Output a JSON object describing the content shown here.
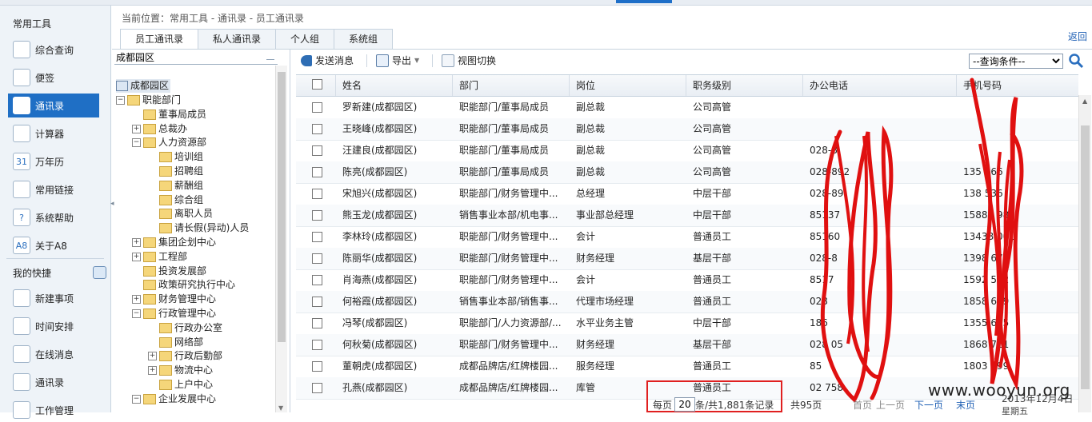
{
  "breadcrumb": "当前位置：常用工具 - 通讯录 - 员工通讯录",
  "back_link": "返回",
  "tabs": [
    "员工通讯录",
    "私人通讯录",
    "个人组",
    "系统组"
  ],
  "sidebar": {
    "section1": "常用工具",
    "items1": [
      {
        "label": "综合查询",
        "icon": "search-doc-icon"
      },
      {
        "label": "便签",
        "icon": "note-icon"
      },
      {
        "label": "通讯录",
        "icon": "contacts-icon",
        "active": true
      },
      {
        "label": "计算器",
        "icon": "calculator-icon"
      },
      {
        "label": "万年历",
        "icon": "calendar-icon",
        "glyph": "31"
      },
      {
        "label": "常用链接",
        "icon": "link-icon"
      },
      {
        "label": "系统帮助",
        "icon": "help-icon",
        "glyph": "?"
      },
      {
        "label": "关于A8",
        "icon": "a8-icon",
        "glyph": "A8"
      }
    ],
    "section2": "我的快捷",
    "items2": [
      {
        "label": "新建事项",
        "icon": "new-item-icon"
      },
      {
        "label": "时间安排",
        "icon": "schedule-icon"
      },
      {
        "label": "在线消息",
        "icon": "message-icon"
      },
      {
        "label": "通讯录",
        "icon": "contacts-icon"
      },
      {
        "label": "工作管理",
        "icon": "work-icon"
      }
    ]
  },
  "tree": {
    "search_value": "成都园区",
    "root": "成都园区",
    "nodes": [
      {
        "label": "职能部门",
        "toggle": "minus",
        "level": 1
      },
      {
        "label": "董事局成员",
        "toggle": "",
        "level": 2
      },
      {
        "label": "总裁办",
        "toggle": "plus",
        "level": 2
      },
      {
        "label": "人力资源部",
        "toggle": "minus",
        "level": 2
      },
      {
        "label": "培训组",
        "toggle": "",
        "level": 3
      },
      {
        "label": "招聘组",
        "toggle": "",
        "level": 3
      },
      {
        "label": "薪酬组",
        "toggle": "",
        "level": 3
      },
      {
        "label": "综合组",
        "toggle": "",
        "level": 3
      },
      {
        "label": "离职人员",
        "toggle": "",
        "level": 3
      },
      {
        "label": "请长假(异动)人员",
        "toggle": "",
        "level": 3
      },
      {
        "label": "集团企划中心",
        "toggle": "plus",
        "level": 2
      },
      {
        "label": "工程部",
        "toggle": "plus",
        "level": 2
      },
      {
        "label": "投资发展部",
        "toggle": "",
        "level": 2
      },
      {
        "label": "政策研究执行中心",
        "toggle": "",
        "level": 2
      },
      {
        "label": "财务管理中心",
        "toggle": "plus",
        "level": 2
      },
      {
        "label": "行政管理中心",
        "toggle": "minus",
        "level": 2
      },
      {
        "label": "行政办公室",
        "toggle": "",
        "level": 3
      },
      {
        "label": "网络部",
        "toggle": "",
        "level": 3
      },
      {
        "label": "行政后勤部",
        "toggle": "plus",
        "level": 3
      },
      {
        "label": "物流中心",
        "toggle": "plus",
        "level": 3
      },
      {
        "label": "上户中心",
        "toggle": "",
        "level": 3
      },
      {
        "label": "企业发展中心",
        "toggle": "minus",
        "level": 2
      }
    ]
  },
  "toolbar": {
    "send_message": "发送消息",
    "export": "导出",
    "view_switch": "视图切换",
    "query_select": "--查询条件--"
  },
  "grid": {
    "headers": [
      "姓名",
      "部门",
      "岗位",
      "职务级别",
      "办公电话",
      "手机号码"
    ],
    "rows": [
      [
        "罗新建(成都园区)",
        "职能部门/董事局成员",
        "副总裁",
        "公司高管",
        "",
        ""
      ],
      [
        "王晓峰(成都园区)",
        "职能部门/董事局成员",
        "副总裁",
        "公司高管",
        "",
        ""
      ],
      [
        "汪建良(成都园区)",
        "职能部门/董事局成员",
        "副总裁",
        "公司高管",
        "028-8",
        ""
      ],
      [
        "陈亮(成都园区)",
        "职能部门/董事局成员",
        "副总裁",
        "公司高管",
        "028-892",
        "135  066"
      ],
      [
        "宋旭兴(成都园区)",
        "职能部门/财务管理中...",
        "总经理",
        "中层干部",
        "028-89",
        "138  536"
      ],
      [
        "熊玉龙(成都园区)",
        "销售事业本部/机电事...",
        "事业部总经理",
        "中层干部",
        "85137",
        "15882  989"
      ],
      [
        "李林玲(成都园区)",
        "职能部门/财务管理中...",
        "会计",
        "普通员工",
        "85160",
        "13438  001"
      ],
      [
        "陈丽华(成都园区)",
        "职能部门/财务管理中...",
        "财务经理",
        "基层干部",
        "028-8",
        "1398  673"
      ],
      [
        "肖海燕(成都园区)",
        "职能部门/财务管理中...",
        "会计",
        "普通员工",
        "8517",
        "1592  512"
      ],
      [
        "何裕霞(成都园区)",
        "销售事业本部/销售事...",
        "代理市场经理",
        "普通员工",
        "028",
        "1858  699"
      ],
      [
        "冯琴(成都园区)",
        "职能部门/人力资源部/...",
        "水平业务主管",
        "中层干部",
        "186",
        "1355  625"
      ],
      [
        "何秋菊(成都园区)",
        "职能部门/财务管理中...",
        "财务经理",
        "基层干部",
        "028  05",
        "1868  711"
      ],
      [
        "董朝虎(成都园区)",
        "成都品牌店/红牌楼园...",
        "服务经理",
        "普通员工",
        "85",
        "1803  599"
      ],
      [
        "孔燕(成都园区)",
        "成都品牌店/红牌楼园...",
        "库管",
        "普通员工",
        "02  758",
        ""
      ]
    ]
  },
  "pager": {
    "per_page_label": "每页",
    "per_page_value": "20",
    "records_label": "条/共1,881条记录",
    "pages_label": "共95页",
    "first": "首页",
    "prev": "上一页",
    "next": "下一页",
    "last": "末页"
  },
  "watermark": "www.wooyun.org",
  "date_stamp": "2013年12月4日",
  "weekday": "星期五",
  "colors": {
    "accent": "#1f6fc5",
    "scribble": "#e01010",
    "highlight_box": "#e02020"
  }
}
